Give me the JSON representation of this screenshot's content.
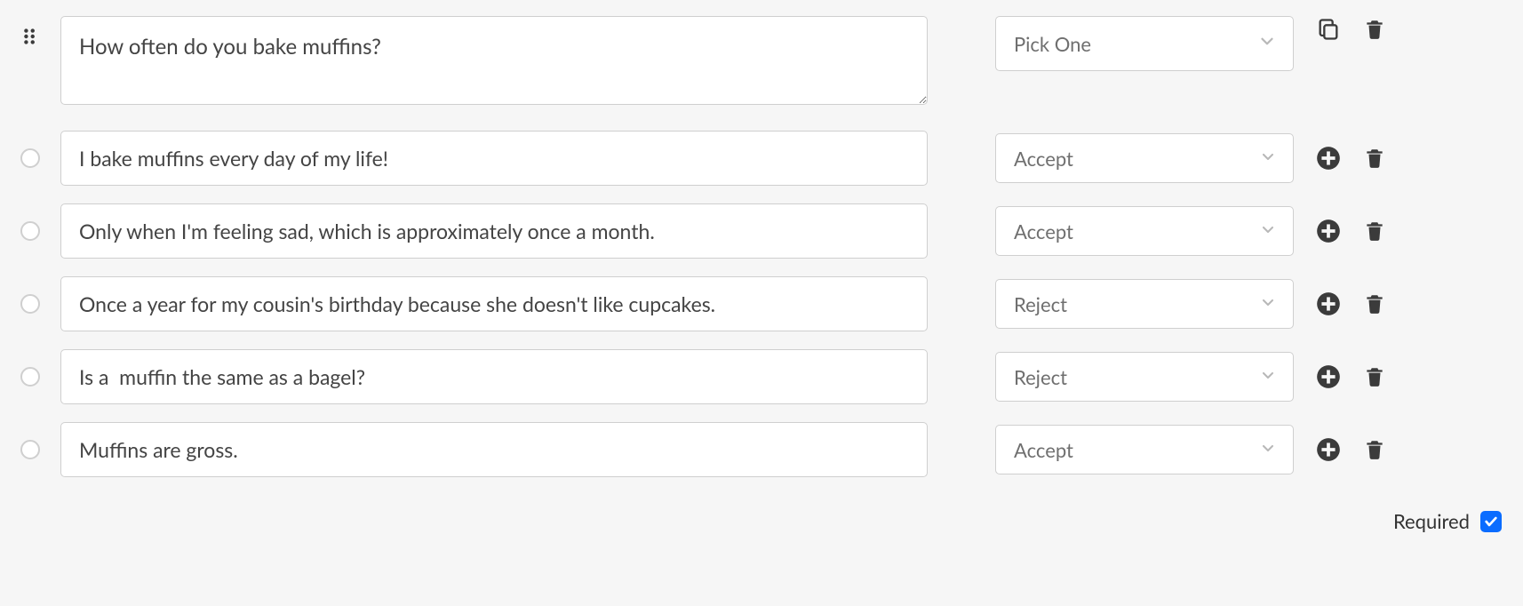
{
  "question": {
    "text": "How often do you bake muffins?",
    "type_label": "Pick One"
  },
  "options": [
    {
      "text": "I bake muffins every day of my life!",
      "action": "Accept"
    },
    {
      "text": "Only when I'm feeling sad, which is approximately once a month.",
      "action": "Accept"
    },
    {
      "text": "Once a year for my cousin's birthday because she doesn't like cupcakes.",
      "action": "Reject"
    },
    {
      "text": "Is a  muffin the same as a bagel?",
      "action": "Reject"
    },
    {
      "text": "Muffins are gross.",
      "action": "Accept"
    }
  ],
  "required": {
    "label": "Required",
    "checked": true
  }
}
